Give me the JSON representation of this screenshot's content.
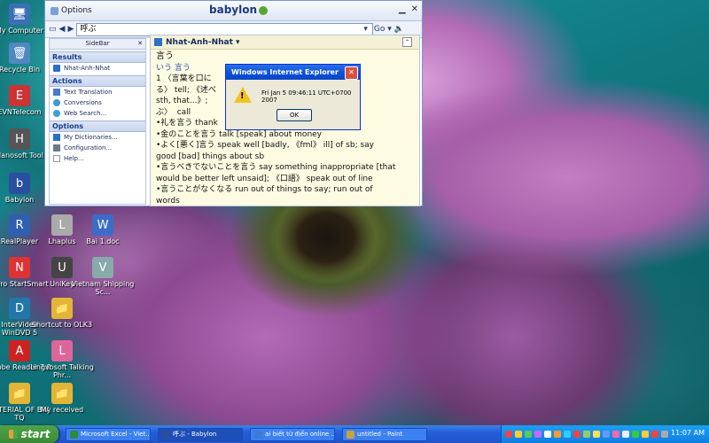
{
  "desktop": {
    "icons": [
      {
        "label": "My Computer",
        "color": "#3a6fb5",
        "glyph": "🖥"
      },
      {
        "label": "Recycle Bin",
        "color": "#4f89c0",
        "glyph": "🗑"
      },
      {
        "label": "EVNTelecom",
        "color": "#c33",
        "glyph": "E"
      },
      {
        "label": "Hanosoft Tool",
        "color": "#555",
        "glyph": "H"
      },
      {
        "label": "Babylon",
        "color": "#2a4fa0",
        "glyph": "b"
      },
      {
        "label": "RealPlayer",
        "color": "#2f5fb2",
        "glyph": "R"
      },
      {
        "label": "Lhaplus",
        "color": "#aaa",
        "glyph": "L"
      },
      {
        "label": "Bai 1.doc",
        "color": "#3b6cc7",
        "glyph": "W"
      },
      {
        "label": "Nero StartSmart",
        "color": "#d33",
        "glyph": "N"
      },
      {
        "label": "UniKey",
        "color": "#444",
        "glyph": "U"
      },
      {
        "label": "Vietnam Shipping Sc...",
        "color": "#8aa",
        "glyph": "V"
      },
      {
        "label": "InterVideo WinDVD 5",
        "color": "#27a",
        "glyph": "D"
      },
      {
        "label": "Shortcut to OLK3",
        "color": "#e2b536",
        "glyph": "📁"
      },
      {
        "label": "Adobe Reader 7.0",
        "color": "#c22",
        "glyph": "A"
      },
      {
        "label": "Lingvosoft Talking Phr...",
        "color": "#d69",
        "glyph": "L"
      },
      {
        "label": "MATERIAL OF BW, TQ",
        "color": "#e2b536",
        "glyph": "📁"
      },
      {
        "label": "My received",
        "color": "#e2b536",
        "glyph": "📁"
      }
    ]
  },
  "babylon": {
    "options_label": "Options",
    "logo": "babylon",
    "search_value": "呼ぶ",
    "go_label": "Go ▾",
    "sidebar_title": "SideBar",
    "sections": {
      "results": "Results",
      "actions": "Actions",
      "options": "Options"
    },
    "results_items": [
      "Nhat-Anh-Nhat"
    ],
    "action_items": [
      "Text Translation",
      "Conversions",
      "Web Search..."
    ],
    "option_items": [
      "My Dictionaries...",
      "Configuration...",
      "Help..."
    ],
    "dict_name": "Nhat-Anh-Nhat ▾",
    "entry_word": "言う",
    "entry_reading": "いう 言う",
    "lines": [
      "1 〈言葉を口に　　　　　　　　　　　　　　　く伝え",
      "る〉 tell; 《述べ　　　　　　　　　　　　　mark 《on",
      "sth, that...》;　　　　　　　　　　　　　　art; 《呼",
      "ぶ〉  call",
      "•礼を言う thank　　　　　　　　　　　　　　de",
      "•金のことを言う talk [speak] about money",
      "•よく[悪く]言う speak well [badly, 《fml》 ill] of sb; say",
      "good [bad] things about sb",
      "•言うべきでないことを言う say something inappropriate [that",
      "would be better left unsaid]; 《口語》 speak out of line",
      "•言うことがなくなる run out of things to say; run out of",
      "words"
    ]
  },
  "dialog": {
    "title": "Windows Internet Explorer",
    "message": "Fri Jan 5 09:46:11 UTC+0700 2007",
    "ok_label": "OK"
  },
  "taskbar": {
    "start_label": "start",
    "tasks": [
      {
        "label": "Microsoft Excel - Viet...",
        "color": "#2b8b3a"
      },
      {
        "label": "呼ぶ - Babylon",
        "color": "#2a4fa0"
      },
      {
        "label": "ai biết từ điển online ...",
        "color": "#3b7bd6"
      },
      {
        "label": "untitled - Paint",
        "color": "#c9a23c"
      }
    ],
    "clock": "11:07 AM"
  }
}
